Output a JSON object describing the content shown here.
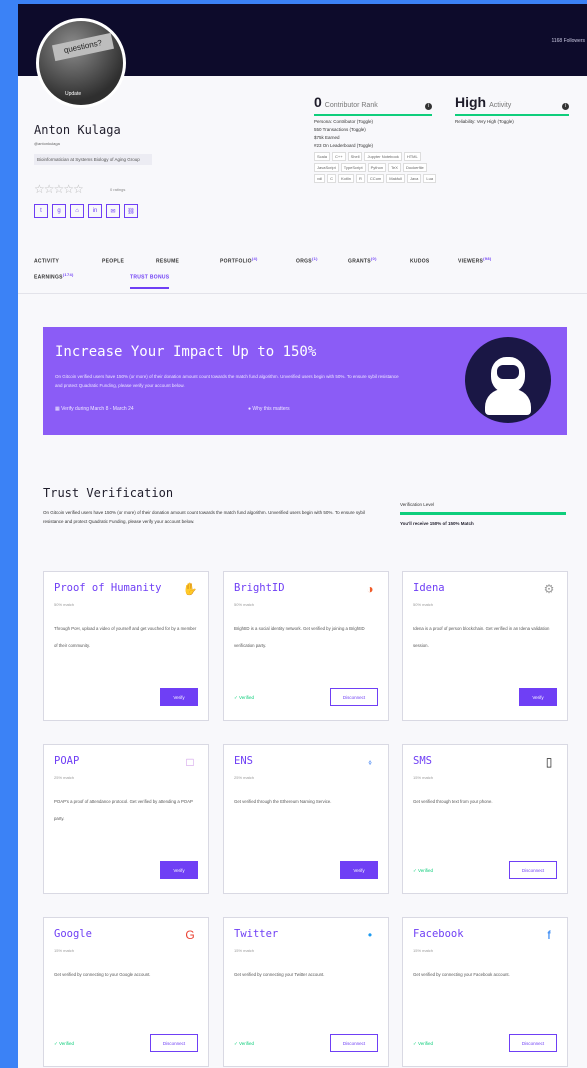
{
  "header": {
    "followers": "1168 Followers"
  },
  "profile": {
    "avatar_text": "questions?",
    "avatar_update": "Update",
    "name": "Anton Kulaga",
    "handle": "@antonkulaga",
    "org": "Bioinformatician at Systems Biology of Aging Group",
    "ratings_label": "0 ratings",
    "socials": [
      "twitter-icon",
      "github-icon",
      "website-icon",
      "linkedin-icon",
      "email-icon",
      "link-icon"
    ]
  },
  "rank": {
    "number": "0",
    "label": "Contributor Rank",
    "persona": "Persona: Contributor (Toggle)",
    "transactions": "550 Transactions (Toggle)",
    "earned": "$75k Earned",
    "leaderboard": "#23 On Leaderboard (Toggle)",
    "tags": [
      "Scala",
      "C++",
      "Shell",
      "Jupyter Notebook",
      "HTML",
      "JavaScript",
      "TypeScript",
      "Python",
      "TeX",
      "Dockerfile",
      "vdl",
      "C",
      "Kotlin",
      "R",
      "CCom",
      "Makfull",
      "Java",
      "Lua"
    ]
  },
  "activity": {
    "big": "High",
    "label": "Activity",
    "reliability": "Reliability: Very High (Toggle)"
  },
  "tabs": [
    {
      "label": "ACTIVITY",
      "sup": ""
    },
    {
      "label": "PEOPLE",
      "sup": ""
    },
    {
      "label": "RESUME",
      "sup": ""
    },
    {
      "label": "PORTFOLIO",
      "sup": "(4)"
    },
    {
      "label": "ORGS",
      "sup": "(1)"
    },
    {
      "label": "GRANTS",
      "sup": "(0)"
    },
    {
      "label": "KUDOS",
      "sup": ""
    },
    {
      "label": "VIEWERS",
      "sup": "(98)"
    },
    {
      "label": "EARNINGS",
      "sup": "(174)"
    },
    {
      "label": "TRUST BONUS",
      "sup": ""
    }
  ],
  "impact": {
    "title": "Increase Your Impact Up to 150%",
    "body": "On Gitcoin verified users have 150% (or more) of their donation amount count towards the match fund algorithm. Unverified users begin with 50%. To ensure sybil resistance and protect Quadratic Funding, please verify your account below.",
    "date": "Verify during March 8 - March 24",
    "why": "Why this matters"
  },
  "trust": {
    "title": "Trust Verification",
    "desc": "On Gitcoin verified users have 150% (or more) of their donation amount count towards the match fund algorithm. Unverified users begin with 50%. To ensure sybil resistance and protect Quadratic Funding, please verify your account below.",
    "level_label": "Verification Level",
    "level_value": "You'll receive 150% of 150% Match"
  },
  "cards": [
    {
      "title": "Proof of Humanity",
      "match": "50% match",
      "desc": "Through PoH, upload a video of yourself and get vouched for by a member of their community.",
      "icon": "poh-icon",
      "glyph": "✋",
      "color": "#f2a33a",
      "state": "verify",
      "button": "Verify",
      "verified": ""
    },
    {
      "title": "BrightID",
      "match": "50% match",
      "desc": "BrightID is a social identity network. Get verified by joining a BrightID verification party.",
      "icon": "brightid-icon",
      "glyph": "◑",
      "color": "#f05c2a",
      "state": "disconnect",
      "button": "Disconnect",
      "verified": "✓ Verified"
    },
    {
      "title": "Idena",
      "match": "50% match",
      "desc": "Idena is a proof of person blockchain. Get verified in an Idena validation session.",
      "icon": "idena-icon",
      "glyph": "⚙",
      "color": "#999999",
      "state": "verify",
      "button": "Verify",
      "verified": ""
    },
    {
      "title": "POAP",
      "match": "25% match",
      "desc": "POAP's a proof of attendance protocol. Get verified by attending a POAP party.",
      "icon": "poap-icon",
      "glyph": "□",
      "color": "#c98ee6",
      "state": "verify",
      "button": "Verify",
      "verified": ""
    },
    {
      "title": "ENS",
      "match": "25% match",
      "desc": "Get verified through the Ethereum Naming Service.",
      "icon": "ens-icon",
      "glyph": "⬫",
      "color": "#4f8df5",
      "state": "verify",
      "button": "Verify",
      "verified": ""
    },
    {
      "title": "SMS",
      "match": "15% match",
      "desc": "Get verified through text from your phone.",
      "icon": "phone-icon",
      "glyph": "▯",
      "color": "#222222",
      "state": "disconnect",
      "button": "Disconnect",
      "verified": "✓ Verified"
    },
    {
      "title": "Google",
      "match": "15% match",
      "desc": "Get verified by connecting to your Google account.",
      "icon": "google-icon",
      "glyph": "G",
      "color": "#ea4335",
      "state": "disconnect",
      "button": "Disconnect",
      "verified": "✓ Verified"
    },
    {
      "title": "Twitter",
      "match": "15% match",
      "desc": "Get verified by connecting your Twitter account.",
      "icon": "twitter-icon",
      "glyph": "•",
      "color": "#1d9bf0",
      "state": "disconnect",
      "button": "Disconnect",
      "verified": "✓ Verified"
    },
    {
      "title": "Facebook",
      "match": "15% match",
      "desc": "Get verified by connecting your Facebook account.",
      "icon": "facebook-icon",
      "glyph": "f",
      "color": "#1877f2",
      "state": "disconnect",
      "button": "Disconnect",
      "verified": "✓ Verified"
    }
  ],
  "colors": {
    "accent": "#6f3ff5",
    "success": "#0fce7c",
    "banner": "#8b5cf6",
    "hero": "#0d0b2b"
  }
}
